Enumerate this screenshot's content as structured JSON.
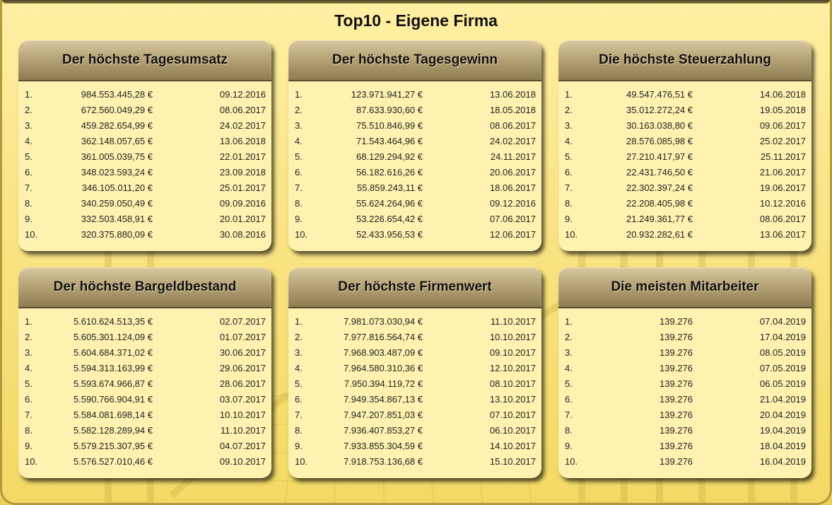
{
  "page_title": "Top10 - Eigene Firma",
  "cards": [
    {
      "title": "Der höchste Tagesumsatz",
      "rows": [
        {
          "rank": "1.",
          "value": "984.553.445,28 €",
          "date": "09.12.2016"
        },
        {
          "rank": "2.",
          "value": "672.560.049,29 €",
          "date": "08.06.2017"
        },
        {
          "rank": "3.",
          "value": "459.282.654,99 €",
          "date": "24.02.2017"
        },
        {
          "rank": "4.",
          "value": "362.148.057,65 €",
          "date": "13.06.2018"
        },
        {
          "rank": "5.",
          "value": "361.005.039,75 €",
          "date": "22.01.2017"
        },
        {
          "rank": "6.",
          "value": "348.023.593,24 €",
          "date": "23.09.2018"
        },
        {
          "rank": "7.",
          "value": "346.105.011,20 €",
          "date": "25.01.2017"
        },
        {
          "rank": "8.",
          "value": "340.259.050,49 €",
          "date": "09.09.2016"
        },
        {
          "rank": "9.",
          "value": "332.503.458,91 €",
          "date": "20.01.2017"
        },
        {
          "rank": "10.",
          "value": "320.375.880,09 €",
          "date": "30.08.2016"
        }
      ]
    },
    {
      "title": "Der höchste Tagesgewinn",
      "rows": [
        {
          "rank": "1.",
          "value": "123.971.941,27 €",
          "date": "13.06.2018"
        },
        {
          "rank": "2.",
          "value": "87.633.930,60 €",
          "date": "18.05.2018"
        },
        {
          "rank": "3.",
          "value": "75.510.846,99 €",
          "date": "08.06.2017"
        },
        {
          "rank": "4.",
          "value": "71.543.464,96 €",
          "date": "24.02.2017"
        },
        {
          "rank": "5.",
          "value": "68.129.294,92 €",
          "date": "24.11.2017"
        },
        {
          "rank": "6.",
          "value": "56.182.616,26 €",
          "date": "20.06.2017"
        },
        {
          "rank": "7.",
          "value": "55.859.243,11 €",
          "date": "18.06.2017"
        },
        {
          "rank": "8.",
          "value": "55.624.264,96 €",
          "date": "09.12.2016"
        },
        {
          "rank": "9.",
          "value": "53.226.654,42 €",
          "date": "07.06.2017"
        },
        {
          "rank": "10.",
          "value": "52.433.956,53 €",
          "date": "12.06.2017"
        }
      ]
    },
    {
      "title": "Die höchste Steuerzahlung",
      "rows": [
        {
          "rank": "1.",
          "value": "49.547.476,51 €",
          "date": "14.06.2018"
        },
        {
          "rank": "2.",
          "value": "35.012.272,24 €",
          "date": "19.05.2018"
        },
        {
          "rank": "3.",
          "value": "30.163.038,80 €",
          "date": "09.06.2017"
        },
        {
          "rank": "4.",
          "value": "28.576.085,98 €",
          "date": "25.02.2017"
        },
        {
          "rank": "5.",
          "value": "27.210.417,97 €",
          "date": "25.11.2017"
        },
        {
          "rank": "6.",
          "value": "22.431.746,50 €",
          "date": "21.06.2017"
        },
        {
          "rank": "7.",
          "value": "22.302.397,24 €",
          "date": "19.06.2017"
        },
        {
          "rank": "8.",
          "value": "22.208.405,98 €",
          "date": "10.12.2016"
        },
        {
          "rank": "9.",
          "value": "21.249.361,77 €",
          "date": "08.06.2017"
        },
        {
          "rank": "10.",
          "value": "20.932.282,61 €",
          "date": "13.06.2017"
        }
      ]
    },
    {
      "title": "Der höchste Bargeldbestand",
      "rows": [
        {
          "rank": "1.",
          "value": "5.610.624.513,35 €",
          "date": "02.07.2017"
        },
        {
          "rank": "2.",
          "value": "5.605.301.124,09 €",
          "date": "01.07.2017"
        },
        {
          "rank": "3.",
          "value": "5.604.684.371,02 €",
          "date": "30.06.2017"
        },
        {
          "rank": "4.",
          "value": "5.594.313.163,99 €",
          "date": "29.06.2017"
        },
        {
          "rank": "5.",
          "value": "5.593.674.966,87 €",
          "date": "28.06.2017"
        },
        {
          "rank": "6.",
          "value": "5.590.766.904,91 €",
          "date": "03.07.2017"
        },
        {
          "rank": "7.",
          "value": "5.584.081.698,14 €",
          "date": "10.10.2017"
        },
        {
          "rank": "8.",
          "value": "5.582.128.289,94 €",
          "date": "11.10.2017"
        },
        {
          "rank": "9.",
          "value": "5.579.215.307,95 €",
          "date": "04.07.2017"
        },
        {
          "rank": "10.",
          "value": "5.576.527.010,46 €",
          "date": "09.10.2017"
        }
      ]
    },
    {
      "title": "Der höchste Firmenwert",
      "rows": [
        {
          "rank": "1.",
          "value": "7.981.073.030,94 €",
          "date": "11.10.2017"
        },
        {
          "rank": "2.",
          "value": "7.977.816.564,74 €",
          "date": "10.10.2017"
        },
        {
          "rank": "3.",
          "value": "7.968.903.487,09 €",
          "date": "09.10.2017"
        },
        {
          "rank": "4.",
          "value": "7.964.580.310,36 €",
          "date": "12.10.2017"
        },
        {
          "rank": "5.",
          "value": "7.950.394.119,72 €",
          "date": "08.10.2017"
        },
        {
          "rank": "6.",
          "value": "7.949.354.867,13 €",
          "date": "13.10.2017"
        },
        {
          "rank": "7.",
          "value": "7.947.207.851,03 €",
          "date": "07.10.2017"
        },
        {
          "rank": "8.",
          "value": "7.936.407.853,27 €",
          "date": "06.10.2017"
        },
        {
          "rank": "9.",
          "value": "7.933.855.304,59 €",
          "date": "14.10.2017"
        },
        {
          "rank": "10.",
          "value": "7.918.753.136,68 €",
          "date": "15.10.2017"
        }
      ]
    },
    {
      "title": "Die meisten Mitarbeiter",
      "rows": [
        {
          "rank": "1.",
          "value": "139.276",
          "date": "07.04.2019"
        },
        {
          "rank": "2.",
          "value": "139.276",
          "date": "17.04.2019"
        },
        {
          "rank": "3.",
          "value": "139.276",
          "date": "08.05.2019"
        },
        {
          "rank": "4.",
          "value": "139.276",
          "date": "07.05.2019"
        },
        {
          "rank": "5.",
          "value": "139.276",
          "date": "06.05.2019"
        },
        {
          "rank": "6.",
          "value": "139.276",
          "date": "21.04.2019"
        },
        {
          "rank": "7.",
          "value": "139.276",
          "date": "20.04.2019"
        },
        {
          "rank": "8.",
          "value": "139.276",
          "date": "19.04.2019"
        },
        {
          "rank": "9.",
          "value": "139.276",
          "date": "18.04.2019"
        },
        {
          "rank": "10.",
          "value": "139.276",
          "date": "16.04.2019"
        }
      ]
    }
  ]
}
